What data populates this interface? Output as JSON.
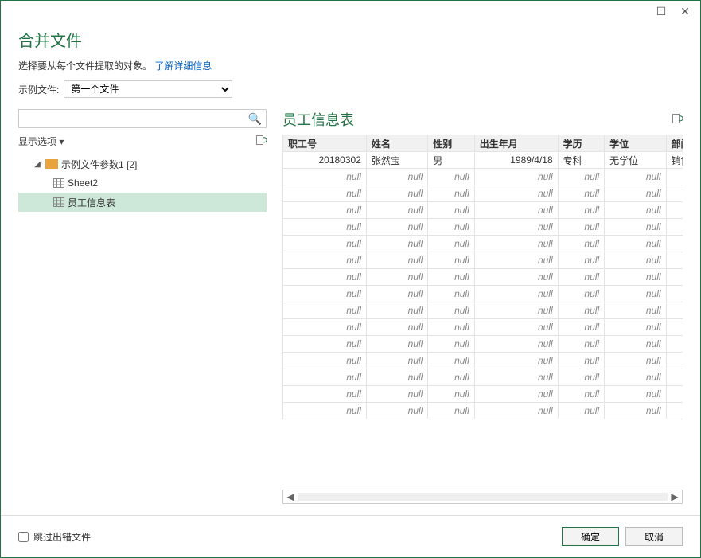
{
  "window": {
    "maximize_glyph": "☐",
    "close_glyph": "✕"
  },
  "header": {
    "title": "合并文件",
    "subtitle_prefix": "选择要从每个文件提取的对象。",
    "learn_more": "了解详细信息"
  },
  "sample": {
    "label": "示例文件:",
    "selected": "第一个文件"
  },
  "search": {
    "placeholder": "",
    "icon": "🔍"
  },
  "options": {
    "display_label": "显示选项",
    "caret": "▾"
  },
  "tree": {
    "root_label": "示例文件参数1 [2]",
    "items": [
      {
        "label": "Sheet2",
        "selected": false
      },
      {
        "label": "员工信息表",
        "selected": true
      }
    ]
  },
  "preview": {
    "title": "员工信息表",
    "columns": [
      "职工号",
      "姓名",
      "性别",
      "出生年月",
      "学历",
      "学位",
      "部门"
    ],
    "rows": [
      [
        "20180302",
        "张然宝",
        "男",
        "1989/4/18",
        "专科",
        "无学位",
        "销售部"
      ],
      [
        null,
        null,
        null,
        null,
        null,
        null,
        null
      ],
      [
        null,
        null,
        null,
        null,
        null,
        null,
        null
      ],
      [
        null,
        null,
        null,
        null,
        null,
        null,
        null
      ],
      [
        null,
        null,
        null,
        null,
        null,
        null,
        null
      ],
      [
        null,
        null,
        null,
        null,
        null,
        null,
        null
      ],
      [
        null,
        null,
        null,
        null,
        null,
        null,
        null
      ],
      [
        null,
        null,
        null,
        null,
        null,
        null,
        null
      ],
      [
        null,
        null,
        null,
        null,
        null,
        null,
        null
      ],
      [
        null,
        null,
        null,
        null,
        null,
        null,
        null
      ],
      [
        null,
        null,
        null,
        null,
        null,
        null,
        null
      ],
      [
        null,
        null,
        null,
        null,
        null,
        null,
        null
      ],
      [
        null,
        null,
        null,
        null,
        null,
        null,
        null
      ],
      [
        null,
        null,
        null,
        null,
        null,
        null,
        null
      ],
      [
        null,
        null,
        null,
        null,
        null,
        null,
        null
      ],
      [
        null,
        null,
        null,
        null,
        null,
        null,
        null
      ]
    ],
    "null_label": "null",
    "text_columns": [
      1,
      2,
      4,
      5,
      6
    ]
  },
  "footer": {
    "skip_errors": "跳过出错文件",
    "ok": "确定",
    "cancel": "取消"
  }
}
